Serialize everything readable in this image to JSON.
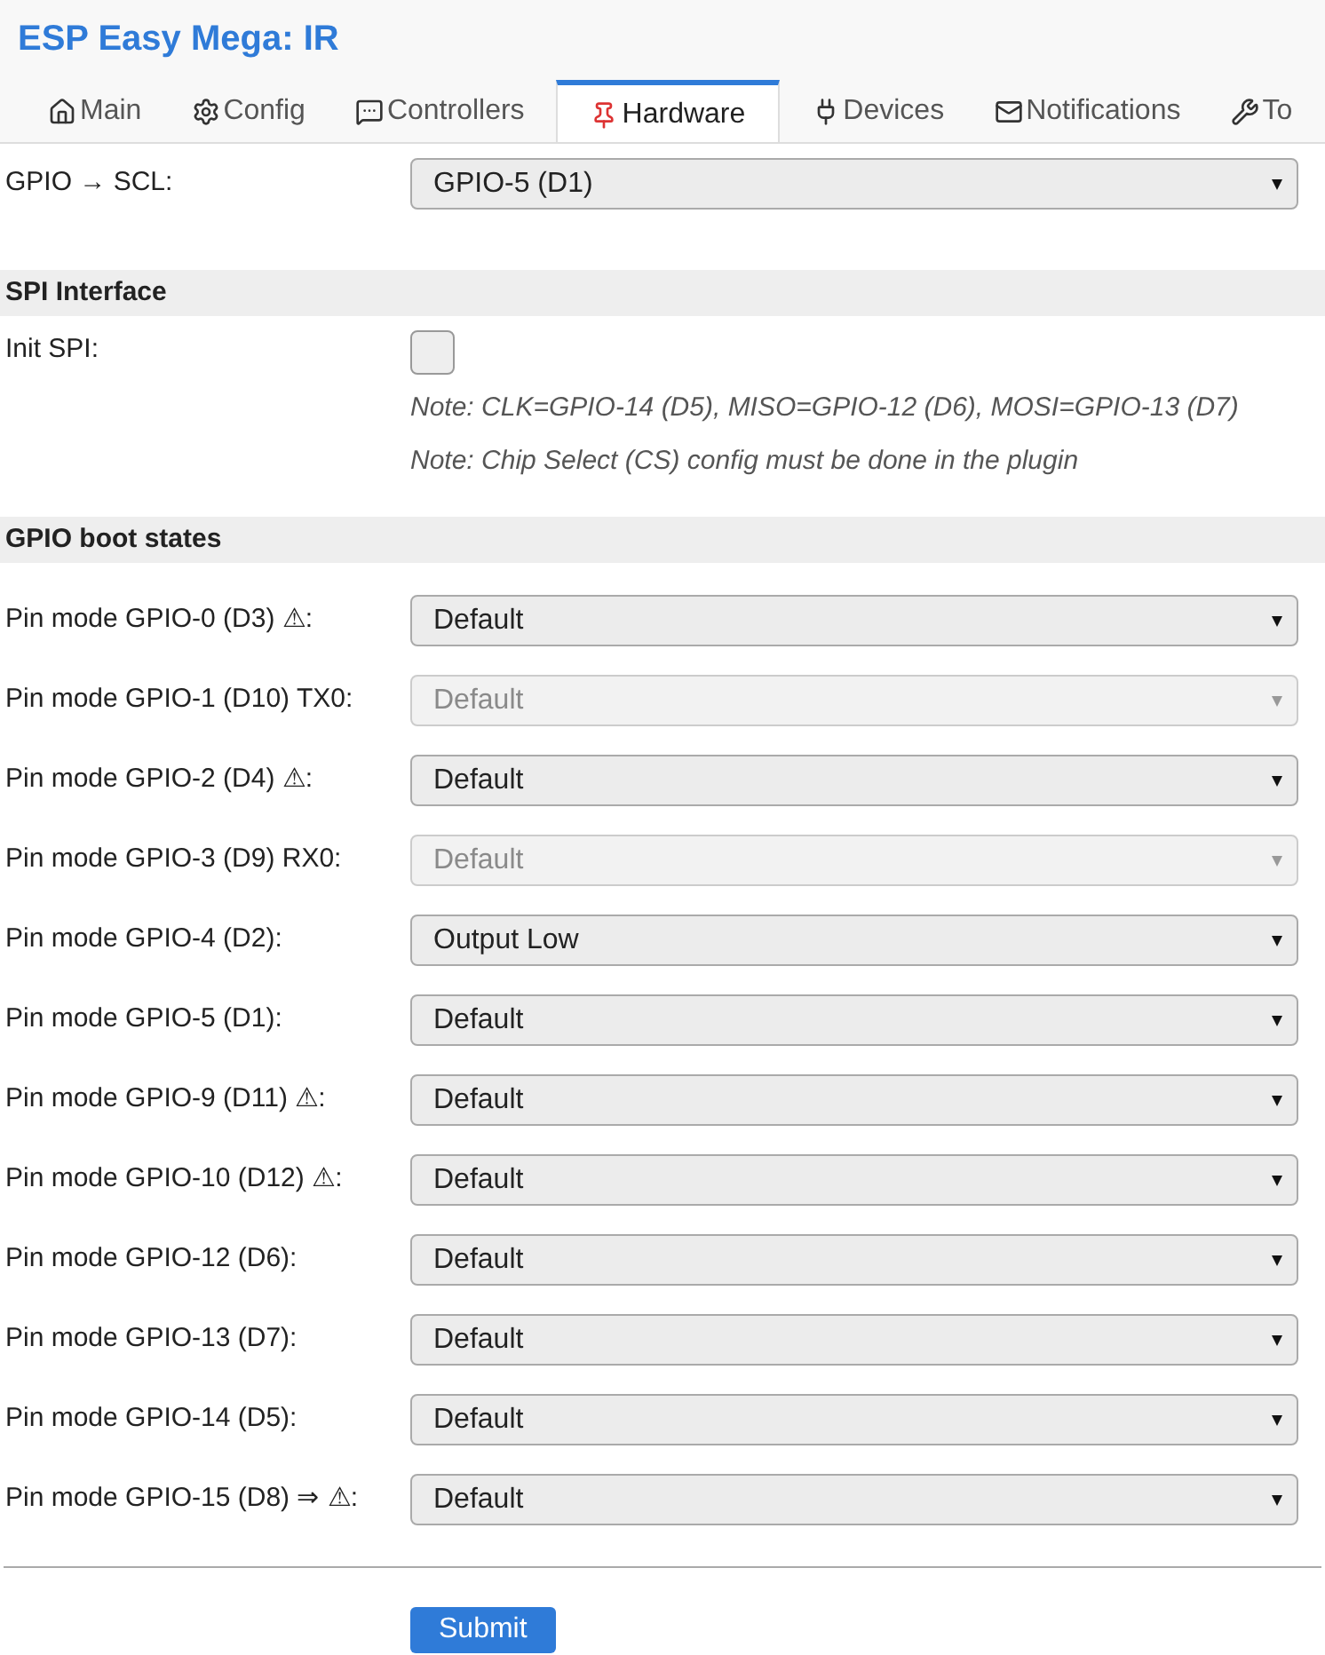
{
  "title": "ESP Easy Mega: IR",
  "tabs": [
    {
      "label": "Main",
      "selected": false
    },
    {
      "label": "Config",
      "selected": false
    },
    {
      "label": "Controllers",
      "selected": false
    },
    {
      "label": "Hardware",
      "selected": true
    },
    {
      "label": "Devices",
      "selected": false
    },
    {
      "label": "Notifications",
      "selected": false
    },
    {
      "label": "To",
      "selected": false
    }
  ],
  "scl": {
    "label": "GPIO → SCL:",
    "value": "GPIO-5 (D1)"
  },
  "spi": {
    "heading": "SPI Interface",
    "label": "Init SPI:",
    "checked": false,
    "notes": [
      "Note: CLK=GPIO-14 (D5), MISO=GPIO-12 (D6), MOSI=GPIO-13 (D7)",
      "Note: Chip Select (CS) config must be done in the plugin"
    ]
  },
  "boot": {
    "heading": "GPIO boot states",
    "rows": [
      {
        "label": "Pin mode GPIO-0 (D3) ⚠:",
        "value": "Default",
        "disabled": false
      },
      {
        "label": "Pin mode GPIO-1 (D10) TX0:",
        "value": "Default",
        "disabled": true
      },
      {
        "label": "Pin mode GPIO-2 (D4) ⚠:",
        "value": "Default",
        "disabled": false
      },
      {
        "label": "Pin mode GPIO-3 (D9) RX0:",
        "value": "Default",
        "disabled": true
      },
      {
        "label": "Pin mode GPIO-4 (D2):",
        "value": "Output Low",
        "disabled": false
      },
      {
        "label": "Pin mode GPIO-5 (D1):",
        "value": "Default",
        "disabled": false
      },
      {
        "label": "Pin mode GPIO-9 (D11) ⚠:",
        "value": "Default",
        "disabled": false
      },
      {
        "label": "Pin mode GPIO-10 (D12) ⚠:",
        "value": "Default",
        "disabled": false
      },
      {
        "label": "Pin mode GPIO-12 (D6):",
        "value": "Default",
        "disabled": false
      },
      {
        "label": "Pin mode GPIO-13 (D7):",
        "value": "Default",
        "disabled": false
      },
      {
        "label": "Pin mode GPIO-14 (D5):",
        "value": "Default",
        "disabled": false
      },
      {
        "label": "Pin mode GPIO-15 (D8) ⇒ ⚠:",
        "value": "Default",
        "disabled": false
      }
    ]
  },
  "submit": "Submit"
}
